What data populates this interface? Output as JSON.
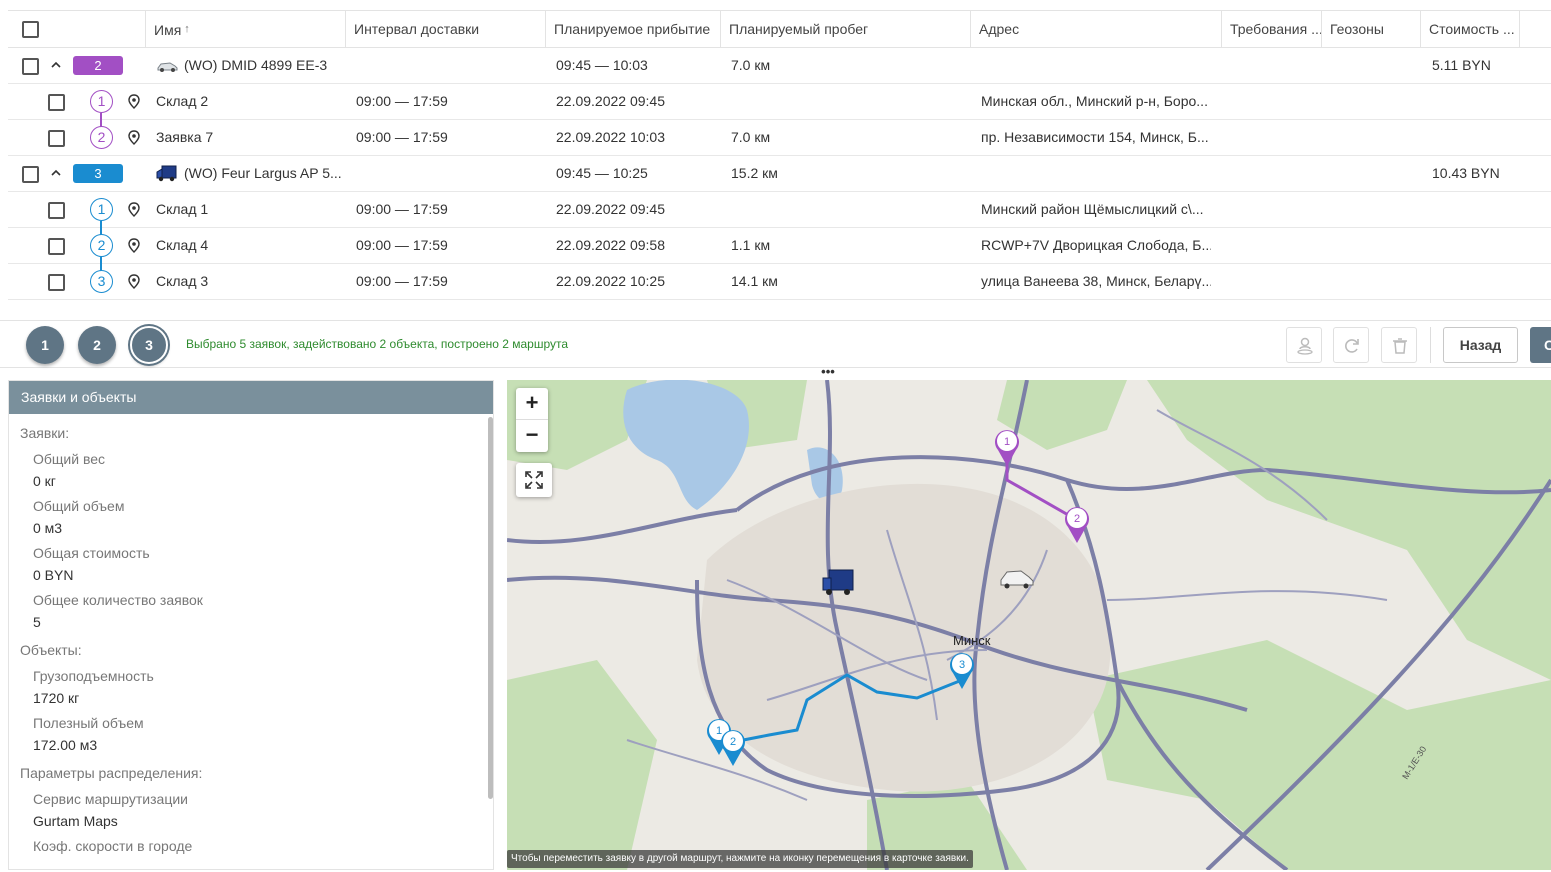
{
  "table": {
    "columns": [
      "Имя",
      "Интервал доставки",
      "Планируемое прибытие",
      "Планируемый пробег",
      "Адрес",
      "Требования ...",
      "Геозоны",
      "Стоимость ..."
    ],
    "sort_icon": "↑",
    "routes": [
      {
        "badge": "2",
        "color": "#a24fc4",
        "vehicle_icon": "car-icon",
        "name": "(WO) DMID 4899 EE-3",
        "arrival": "09:45 — 10:03",
        "mileage": "7.0 км",
        "cost": "5.11 BYN",
        "stops": [
          {
            "num": "1",
            "name": "Склад 2",
            "interval": "09:00 — 17:59",
            "arrival": "22.09.2022 09:45",
            "mileage": "",
            "address": "Минская обл., Минский р-н, Боро..."
          },
          {
            "num": "2",
            "name": "Заявка 7",
            "interval": "09:00 — 17:59",
            "arrival": "22.09.2022 10:03",
            "mileage": "7.0 км",
            "address": "пр. Независимости 154, Минск, Б..."
          }
        ]
      },
      {
        "badge": "3",
        "color": "#1a8cd0",
        "vehicle_icon": "truck-icon",
        "name": "(WO) Feur Largus AP 5...",
        "arrival": "09:45 — 10:25",
        "mileage": "15.2 км",
        "cost": "10.43 BYN",
        "stops": [
          {
            "num": "1",
            "name": "Склад 1",
            "interval": "09:00 — 17:59",
            "arrival": "22.09.2022 09:45",
            "mileage": "",
            "address": "Минский район Щёмыслицкий с\\..."
          },
          {
            "num": "2",
            "name": "Склад 4",
            "interval": "09:00 — 17:59",
            "arrival": "22.09.2022 09:58",
            "mileage": "1.1 км",
            "address": "RCWP+7V Дворицкая Слобода, Б..."
          },
          {
            "num": "3",
            "name": "Склад 3",
            "interval": "09:00 — 17:59",
            "arrival": "22.09.2022 10:25",
            "mileage": "14.1 км",
            "address": "улица Ванеева 38, Минск, Беларү..."
          }
        ]
      }
    ]
  },
  "actionbar": {
    "route_buttons": [
      "1",
      "2",
      "3"
    ],
    "status": "Выбрано 5 заявок, задействовано 2 объекта, построено 2 маршрута",
    "back_label": "Назад",
    "next_label": "С"
  },
  "panel": {
    "title": "Заявки и объекты",
    "orders_label": "Заявки:",
    "total_weight_label": "Общий вес",
    "total_weight": "0 кг",
    "total_volume_label": "Общий объем",
    "total_volume": "0 м3",
    "total_cost_label": "Общая стоимость",
    "total_cost": "0 BYN",
    "total_count_label": "Общее количество заявок",
    "total_count": "5",
    "objects_label": "Объекты:",
    "capacity_label": "Грузоподъемность",
    "capacity": "1720 кг",
    "useful_volume_label": "Полезный объем",
    "useful_volume": "172.00 м3",
    "params_label": "Параметры распределения:",
    "routing_label": "Сервис маршрутизации",
    "routing": "Gurtam Maps",
    "speed_label": "Коэф. скорости в городе"
  },
  "map": {
    "city": "Минск",
    "hint": "Чтобы переместить заявку в другой маршрут, нажмите на иконку перемещения в карточке заявки.",
    "zoom_in": "+",
    "zoom_out": "−",
    "road_labels": [
      "М-1/Е-30"
    ]
  }
}
